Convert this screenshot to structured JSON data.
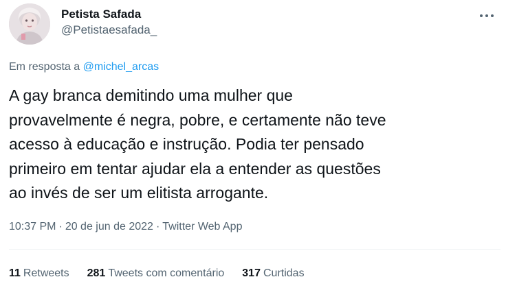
{
  "author": {
    "display_name": "Petista Safada",
    "handle": "@Petistaesafada_"
  },
  "reply": {
    "prefix": "Em resposta a",
    "mention": "@michel_arcas"
  },
  "tweet": {
    "text": "A gay branca demitindo uma mulher que\nprovavelmente é negra, pobre, e certamente não teve\nacesso à educação e instrução. Podia ter pensado\nprimeiro em tentar ajudar ela a entender as questões\nao invés de ser um elitista arrogante."
  },
  "meta": {
    "time": "10:37 PM",
    "separator": "·",
    "date": "20 de jun de 2022",
    "source": "Twitter Web App"
  },
  "stats": {
    "retweets_count": "11",
    "retweets_label": "Retweets",
    "quotes_count": "281",
    "quotes_label": "Tweets com comentário",
    "likes_count": "317",
    "likes_label": "Curtidas"
  },
  "icons": {
    "more": "more-horizontal-icon"
  },
  "colors": {
    "primary_text": "#0f1419",
    "secondary_text": "#536471",
    "link": "#1d9bf0",
    "divider": "#eff3f4"
  }
}
